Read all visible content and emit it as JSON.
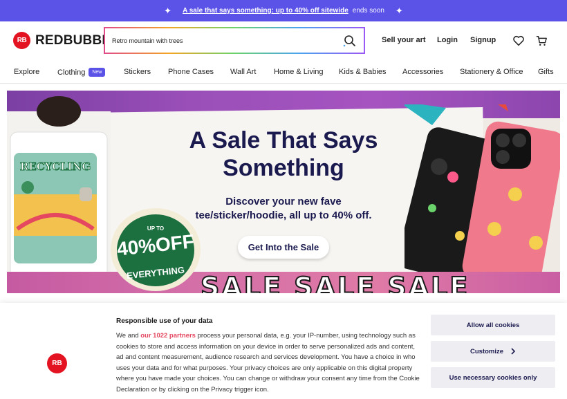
{
  "promo": {
    "link_text": "A sale that says something: up to 40% off sitewide",
    "suffix": "ends soon"
  },
  "header": {
    "logo_text": "REDBUBBLE",
    "logo_mark": "RB",
    "search_value": "Retro mountain with trees",
    "sell_label": "Sell your art",
    "login_label": "Login",
    "signup_label": "Signup"
  },
  "nav": {
    "items": [
      {
        "label": "Explore"
      },
      {
        "label": "Clothing",
        "badge": "New"
      },
      {
        "label": "Stickers"
      },
      {
        "label": "Phone Cases"
      },
      {
        "label": "Wall Art"
      },
      {
        "label": "Home & Living"
      },
      {
        "label": "Kids & Babies"
      },
      {
        "label": "Accessories"
      },
      {
        "label": "Stationery & Office"
      },
      {
        "label": "Gifts"
      }
    ]
  },
  "hero": {
    "title_line1": "A Sale That Says",
    "title_line2": "Something",
    "subtitle_line1": "Discover your new fave",
    "subtitle_line2": "tee/sticker/hoodie, all up to 40% off.",
    "cta": "Get Into the Sale",
    "sticker_top": "UP TO",
    "sticker_big": "40%OFF",
    "sticker_bottom": "EVERYTHING",
    "banner_text": "SALE SALE SALE"
  },
  "cookie": {
    "title": "Responsible use of your data",
    "body_prefix": "We and ",
    "partners_link": "our 1022 partners",
    "body_rest": " process your personal data, e.g. your IP-number, using technology such as cookies to store and access information on your device in order to serve personalized ads and content, ad and content measurement, audience research and services development. You have a choice in who uses your data and for what purposes. Your privacy choices are only applicable on this digital property where you have made your choices. You can change or withdraw your consent any time from the Cookie Declaration or by clicking on the Privacy trigger icon.",
    "allow_all": "Allow all cookies",
    "customize": "Customize",
    "necessary_only": "Use necessary cookies only"
  },
  "colors": {
    "promo_bg": "#5b52e8",
    "brand_red": "#e41321",
    "hero_navy": "#1b1a4f",
    "partners_link": "#e4475f"
  },
  "icons": [
    "sparkle-icon",
    "search-icon",
    "heart-icon",
    "cart-icon",
    "chevron-right-icon"
  ]
}
